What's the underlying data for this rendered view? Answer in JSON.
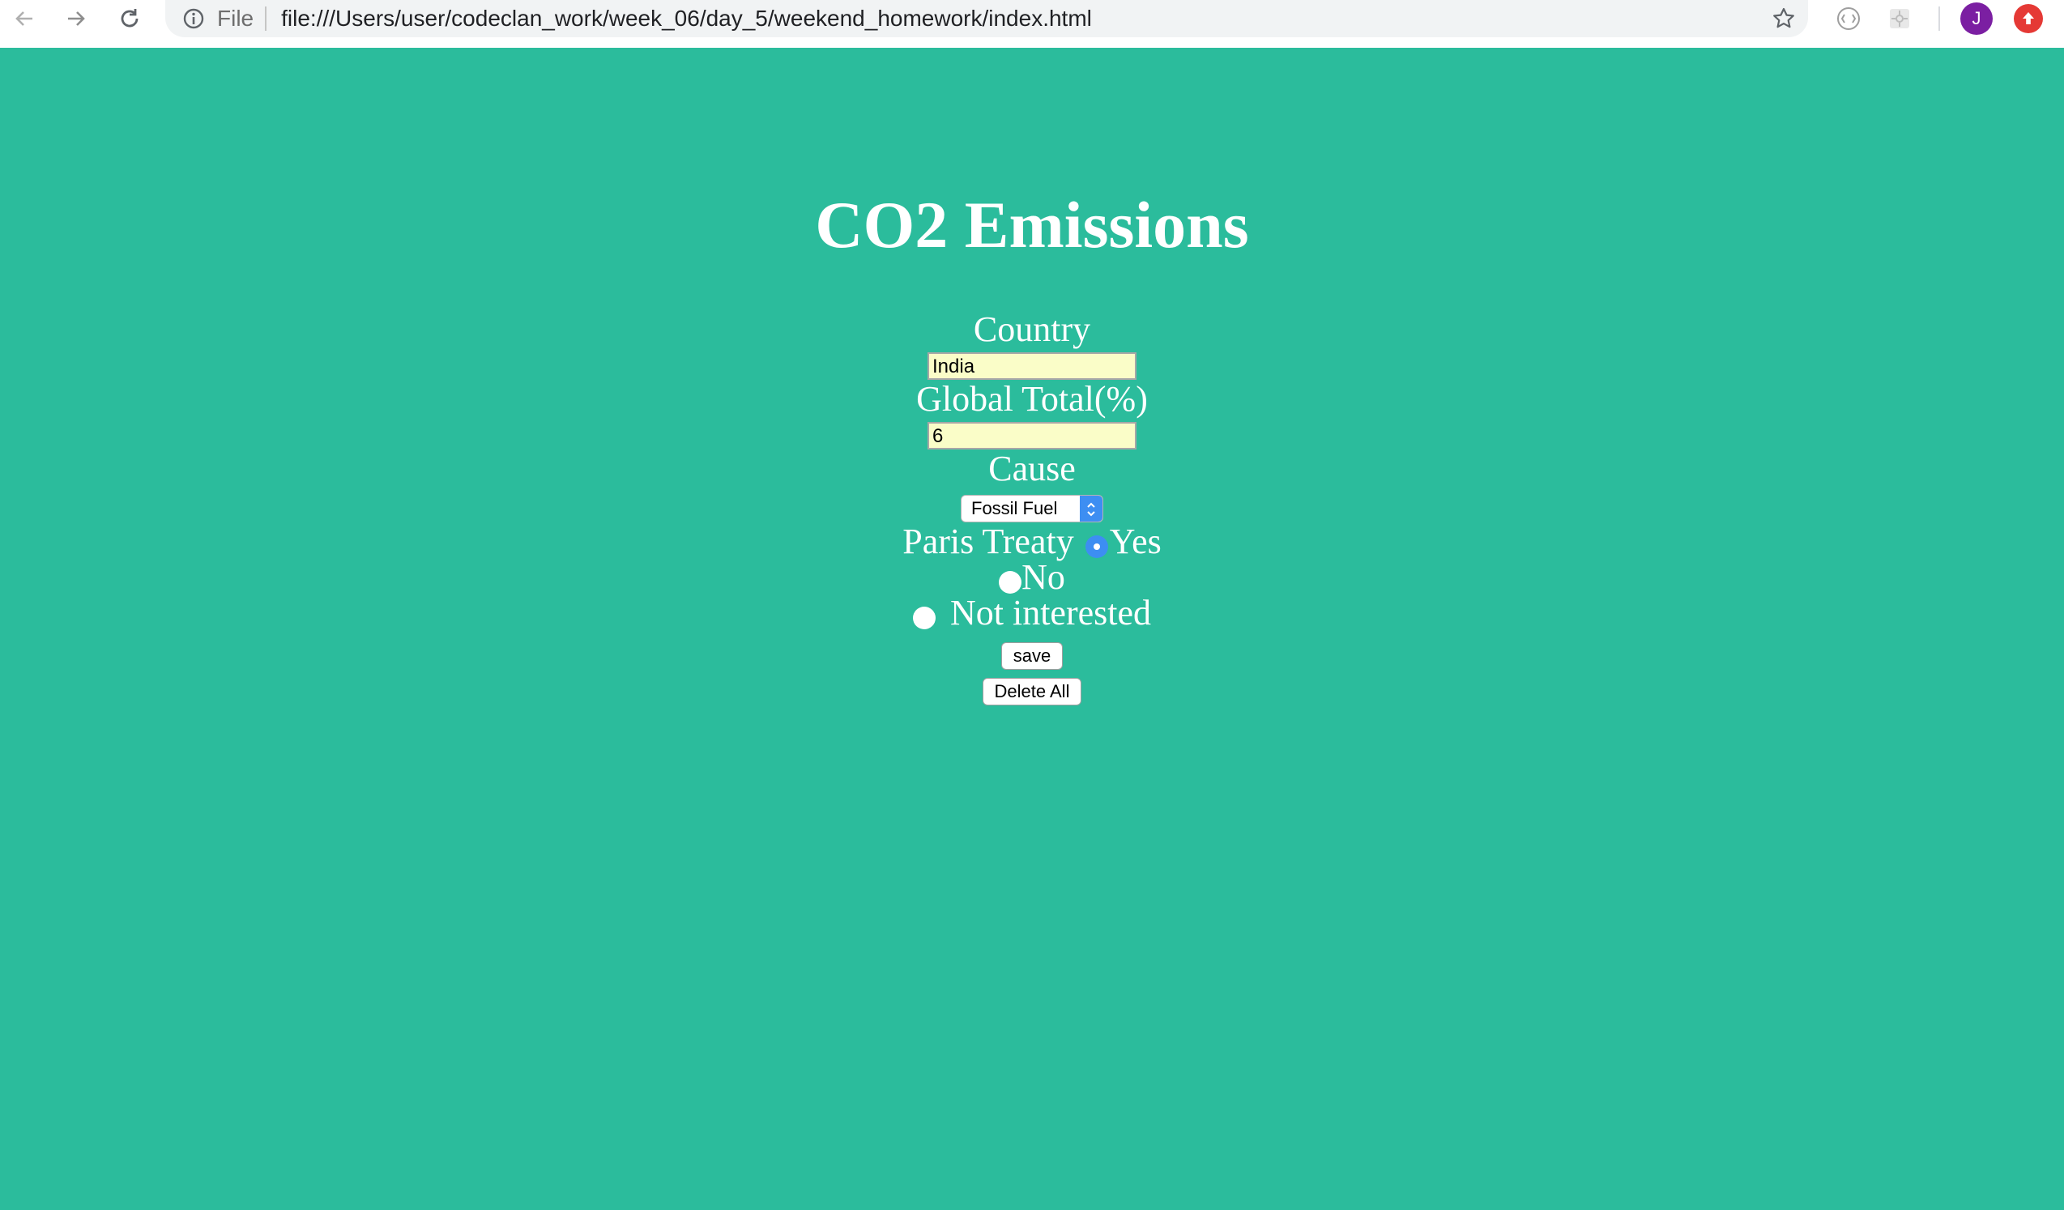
{
  "browser": {
    "scheme_label": "File",
    "url": "file:///Users/user/codeclan_work/week_06/day_5/weekend_homework/index.html",
    "profile_initial": "J",
    "icons": [
      "back-arrow-icon",
      "forward-arrow-icon",
      "reload-icon",
      "info-icon",
      "star-icon",
      "extension-icon",
      "extension-icon",
      "update-icon"
    ]
  },
  "page": {
    "title": "CO2 Emissions",
    "background_color": "#2bbc9c",
    "form": {
      "country_label": "Country",
      "country_value": "India",
      "global_total_label": "Global Total(%)",
      "global_total_value": "6",
      "cause_label": "Cause",
      "cause_selected": "Fossil Fuel",
      "paris_label": "Paris Treaty",
      "paris_options": [
        {
          "label": "Yes",
          "checked": true
        },
        {
          "label": "No",
          "checked": false
        },
        {
          "label": "Not interested",
          "checked": false
        }
      ],
      "save_label": "save",
      "delete_label": "Delete All"
    }
  }
}
